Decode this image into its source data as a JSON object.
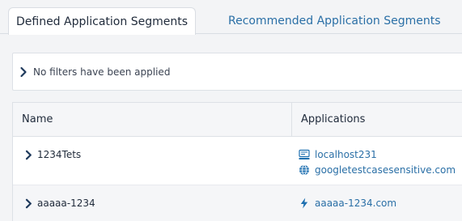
{
  "tabs": [
    {
      "label": "Defined Application Segments",
      "active": true
    },
    {
      "label": "Recommended Application Segments",
      "active": false
    }
  ],
  "filter": {
    "text": "No filters have been applied",
    "icon": "chevron-right-icon"
  },
  "table": {
    "columns": [
      "Name",
      "Applications"
    ],
    "rows": [
      {
        "name": "1234Tets",
        "applications": [
          {
            "label": "localhost231",
            "icon": "server-icon"
          },
          {
            "label": "googletestcasesensitive.com",
            "icon": "globe-icon"
          }
        ]
      },
      {
        "name": "aaaaa-1234",
        "applications": [
          {
            "label": "aaaaa-1234.com",
            "icon": "lightning-icon"
          }
        ]
      }
    ]
  },
  "colors": {
    "link": "#2a6fa6",
    "icon_blue": "#1d6fb0",
    "chevron": "#1f3a5c"
  }
}
